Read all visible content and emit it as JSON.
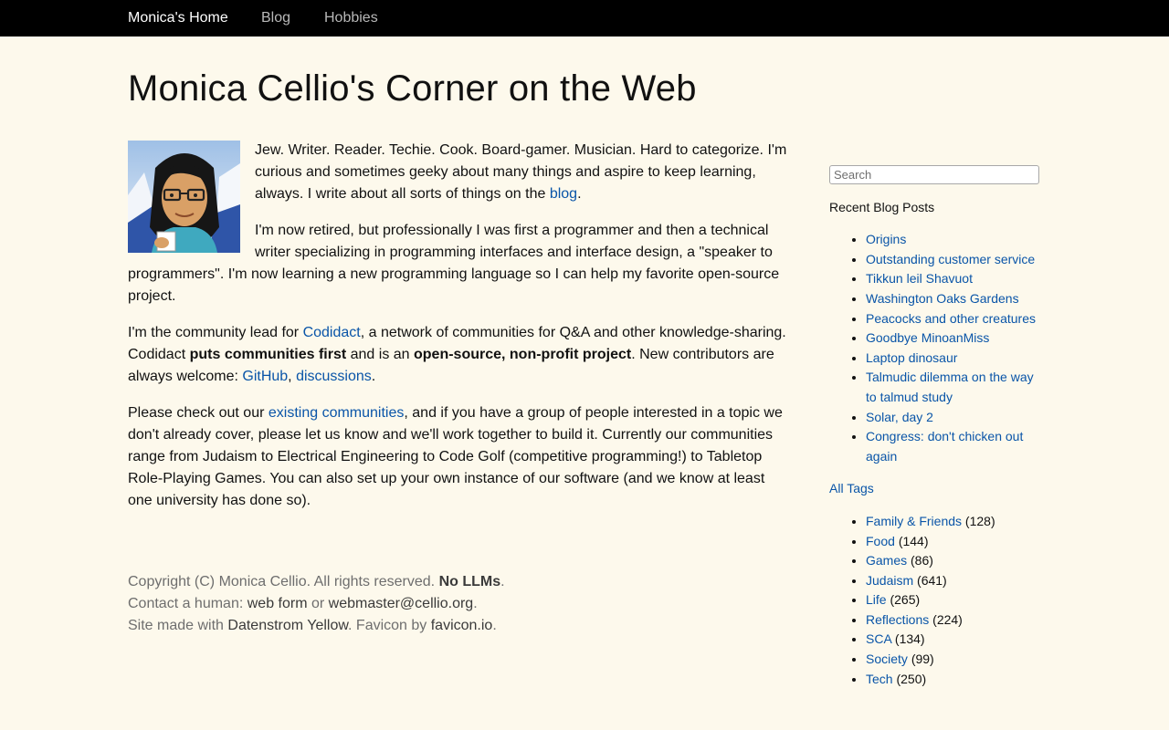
{
  "nav": {
    "home": "Monica's Home",
    "blog": "Blog",
    "hobbies": "Hobbies"
  },
  "page": {
    "title": "Monica Cellio's Corner on the Web"
  },
  "intro": {
    "p1_text": "Jew. Writer. Reader. Techie. Cook. Board-gamer. Musician. Hard to categorize. I'm curious and sometimes geeky about many things and aspire to keep learning, always. I write about all sorts of things on the ",
    "p1_link": "blog",
    "p1_end": ".",
    "p2": "I'm now retired, but professionally I was first a programmer and then a technical writer specializing in programming interfaces and interface design, a \"speaker to programmers\". I'm now learning a new programming language so I can help my favorite open-source project.",
    "p3_a": "I'm the community lead for ",
    "p3_link": "Codidact",
    "p3_b": ", a network of communities for Q&A and other knowledge-sharing. Codidact ",
    "p3_bold1": "puts communities first",
    "p3_c": " and is an ",
    "p3_bold2": "open-source, non-profit project",
    "p3_d": ". New contributors are always welcome: ",
    "p3_link_github": "GitHub",
    "p3_sep": ", ",
    "p3_link_disc": "discussions",
    "p3_end": ".",
    "p4_a": "Please check out our ",
    "p4_link": "existing communities",
    "p4_b": ", and if you have a group of people interested in a topic we don't already cover, please let us know and we'll work together to build it. Currently our communities range from Judaism to Electrical Engineering to Code Golf (competitive programming!) to Tabletop Role-Playing Games. You can also set up your own instance of our software (and we know at least one university has done so)."
  },
  "footer": {
    "line1": "Copyright (C) Monica Cellio. All rights reserved. ",
    "line1_bold": "No LLMs",
    "line1_end": ".",
    "line2_a": "Contact a human: ",
    "line2_link1": "web form",
    "line2_or": " or ",
    "line2_link2": "webmaster@cellio.org",
    "line2_end": ".",
    "line3_a": "Site made with ",
    "line3_link1": "Datenstrom Yellow",
    "line3_b": ". Favicon by ",
    "line3_link2": "favicon.io",
    "line3_end": "."
  },
  "sidebar": {
    "search_placeholder": "Search",
    "recent_title": "Recent Blog Posts",
    "recent_posts": [
      "Origins",
      "Outstanding customer service",
      "Tikkun leil Shavuot",
      "Washington Oaks Gardens",
      "Peacocks and other creatures",
      "Goodbye MinoanMiss",
      "Laptop dinosaur",
      "Talmudic dilemma on the way to talmud study",
      "Solar, day 2",
      "Congress: don't chicken out again"
    ],
    "all_tags": "All Tags",
    "tags": [
      {
        "name": "Family & Friends",
        "count": "(128)"
      },
      {
        "name": "Food",
        "count": "(144)"
      },
      {
        "name": "Games",
        "count": "(86)"
      },
      {
        "name": "Judaism",
        "count": "(641)"
      },
      {
        "name": "Life",
        "count": "(265)"
      },
      {
        "name": "Reflections",
        "count": "(224)"
      },
      {
        "name": "SCA",
        "count": "(134)"
      },
      {
        "name": "Society",
        "count": "(99)"
      },
      {
        "name": "Tech",
        "count": "(250)"
      }
    ]
  },
  "icons": {
    "avatar": "avatar-portrait-icon"
  },
  "colors": {
    "background": "#fdf9ec",
    "nav_background": "#000000",
    "link": "#0a55a8",
    "footer_text": "#6e6e6e"
  }
}
